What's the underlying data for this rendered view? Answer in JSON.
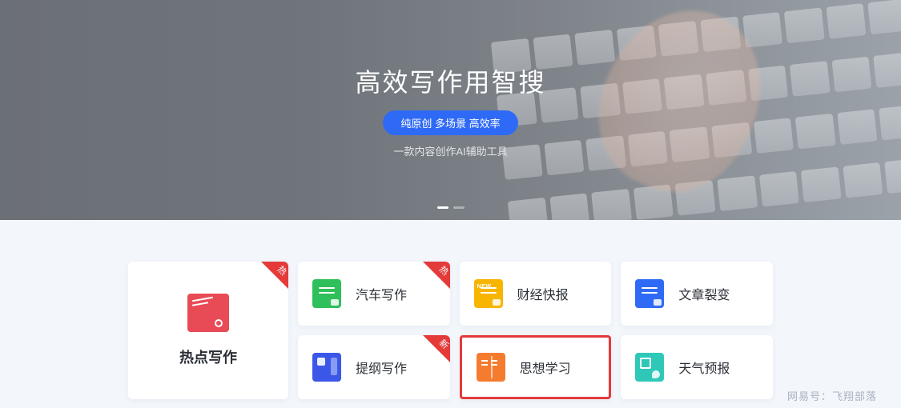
{
  "hero": {
    "title": "高效写作用智搜",
    "badge": "纯原创 多场景 高效率",
    "subtitle": "一款内容创作AI辅助工具"
  },
  "ribbons": {
    "hot": "热",
    "new": "新"
  },
  "cards": {
    "big": {
      "label": "热点写作"
    },
    "auto": {
      "label": "汽车写作"
    },
    "finance": {
      "label": "财经快报"
    },
    "split": {
      "label": "文章裂变"
    },
    "outline": {
      "label": "提纲写作"
    },
    "study": {
      "label": "思想学习"
    },
    "weather": {
      "label": "天气预报"
    }
  },
  "watermark": "网易号：飞翔部落",
  "colors": {
    "accent": "#2f6af6",
    "danger": "#e43a3a"
  }
}
